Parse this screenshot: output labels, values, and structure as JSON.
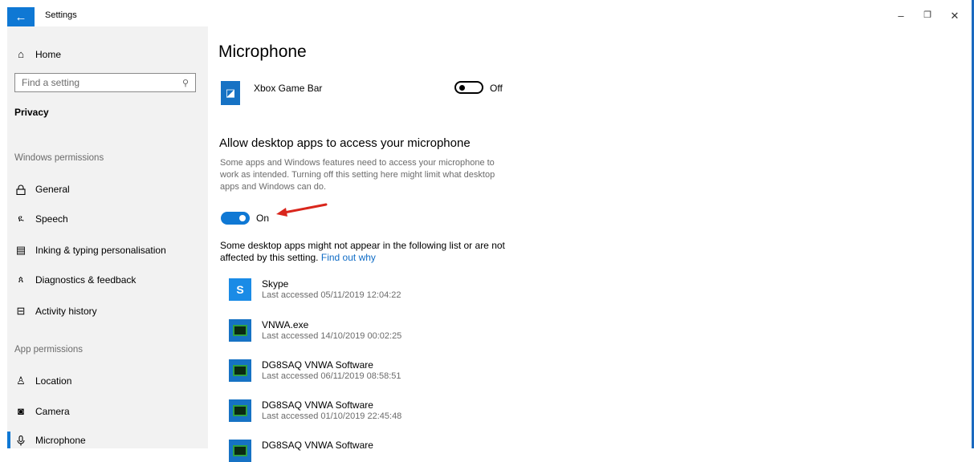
{
  "window": {
    "title": "Settings",
    "back_glyph": "←",
    "minimize_glyph": "–",
    "maximize_glyph": "❐",
    "close_glyph": "✕"
  },
  "sidebar": {
    "home": {
      "label": "Home",
      "icon": "home-icon",
      "glyph": "⌂"
    },
    "search": {
      "placeholder": "Find a setting",
      "icon": "search-icon",
      "glyph": "⚲"
    },
    "section": "Privacy",
    "windows_permissions": {
      "title": "Windows permissions",
      "items": [
        {
          "label": "General",
          "icon": "lock-icon",
          "glyph": "🔒"
        },
        {
          "label": "Speech",
          "icon": "speech-icon",
          "glyph": "ዪ"
        },
        {
          "label": "Inking & typing personalisation",
          "icon": "clipboard-icon",
          "glyph": "▤"
        },
        {
          "label": "Diagnostics & feedback",
          "icon": "diagnostics-icon",
          "glyph": "ጰ"
        },
        {
          "label": "Activity history",
          "icon": "activity-icon",
          "glyph": "⊟"
        }
      ]
    },
    "app_permissions": {
      "title": "App permissions",
      "items": [
        {
          "label": "Location",
          "icon": "location-icon",
          "glyph": "♙"
        },
        {
          "label": "Camera",
          "icon": "camera-icon",
          "glyph": "◙"
        },
        {
          "label": "Microphone",
          "icon": "microphone-icon",
          "glyph": "🎙"
        }
      ]
    }
  },
  "main": {
    "title": "Microphone",
    "xbox": {
      "name": "Xbox Game Bar",
      "toggle_state": "Off",
      "icon": "xbox-game-bar-icon",
      "glyph": "◪"
    },
    "desktop_heading": "Allow desktop apps to access your microphone",
    "desktop_description": "Some apps and Windows features need to access your microphone to work as intended. Turning off this setting here might limit what desktop apps and Windows can do.",
    "desktop_toggle_state": "On",
    "note_text": "Some desktop apps might not appear in the following list or are not affected by this setting.",
    "note_link": "Find out why",
    "apps": [
      {
        "name": "Skype",
        "last_accessed": "Last accessed 05/11/2019 12:04:22",
        "icon": "skype-icon",
        "glyph": "S"
      },
      {
        "name": "VNWA.exe",
        "last_accessed": "Last accessed 14/10/2019 00:02:25",
        "icon": "vnwa-icon"
      },
      {
        "name": "DG8SAQ VNWA Software",
        "last_accessed": "Last accessed 06/11/2019 08:58:51",
        "icon": "vnwa-icon"
      },
      {
        "name": "DG8SAQ VNWA Software",
        "last_accessed": "Last accessed 01/10/2019 22:45:48",
        "icon": "vnwa-icon"
      },
      {
        "name": "DG8SAQ VNWA Software",
        "last_accessed": "",
        "icon": "vnwa-icon"
      }
    ]
  },
  "colors": {
    "accent": "#0f78d4",
    "annotation_arrow": "#d9261c",
    "sidebar_bg": "#f2f2f2"
  }
}
